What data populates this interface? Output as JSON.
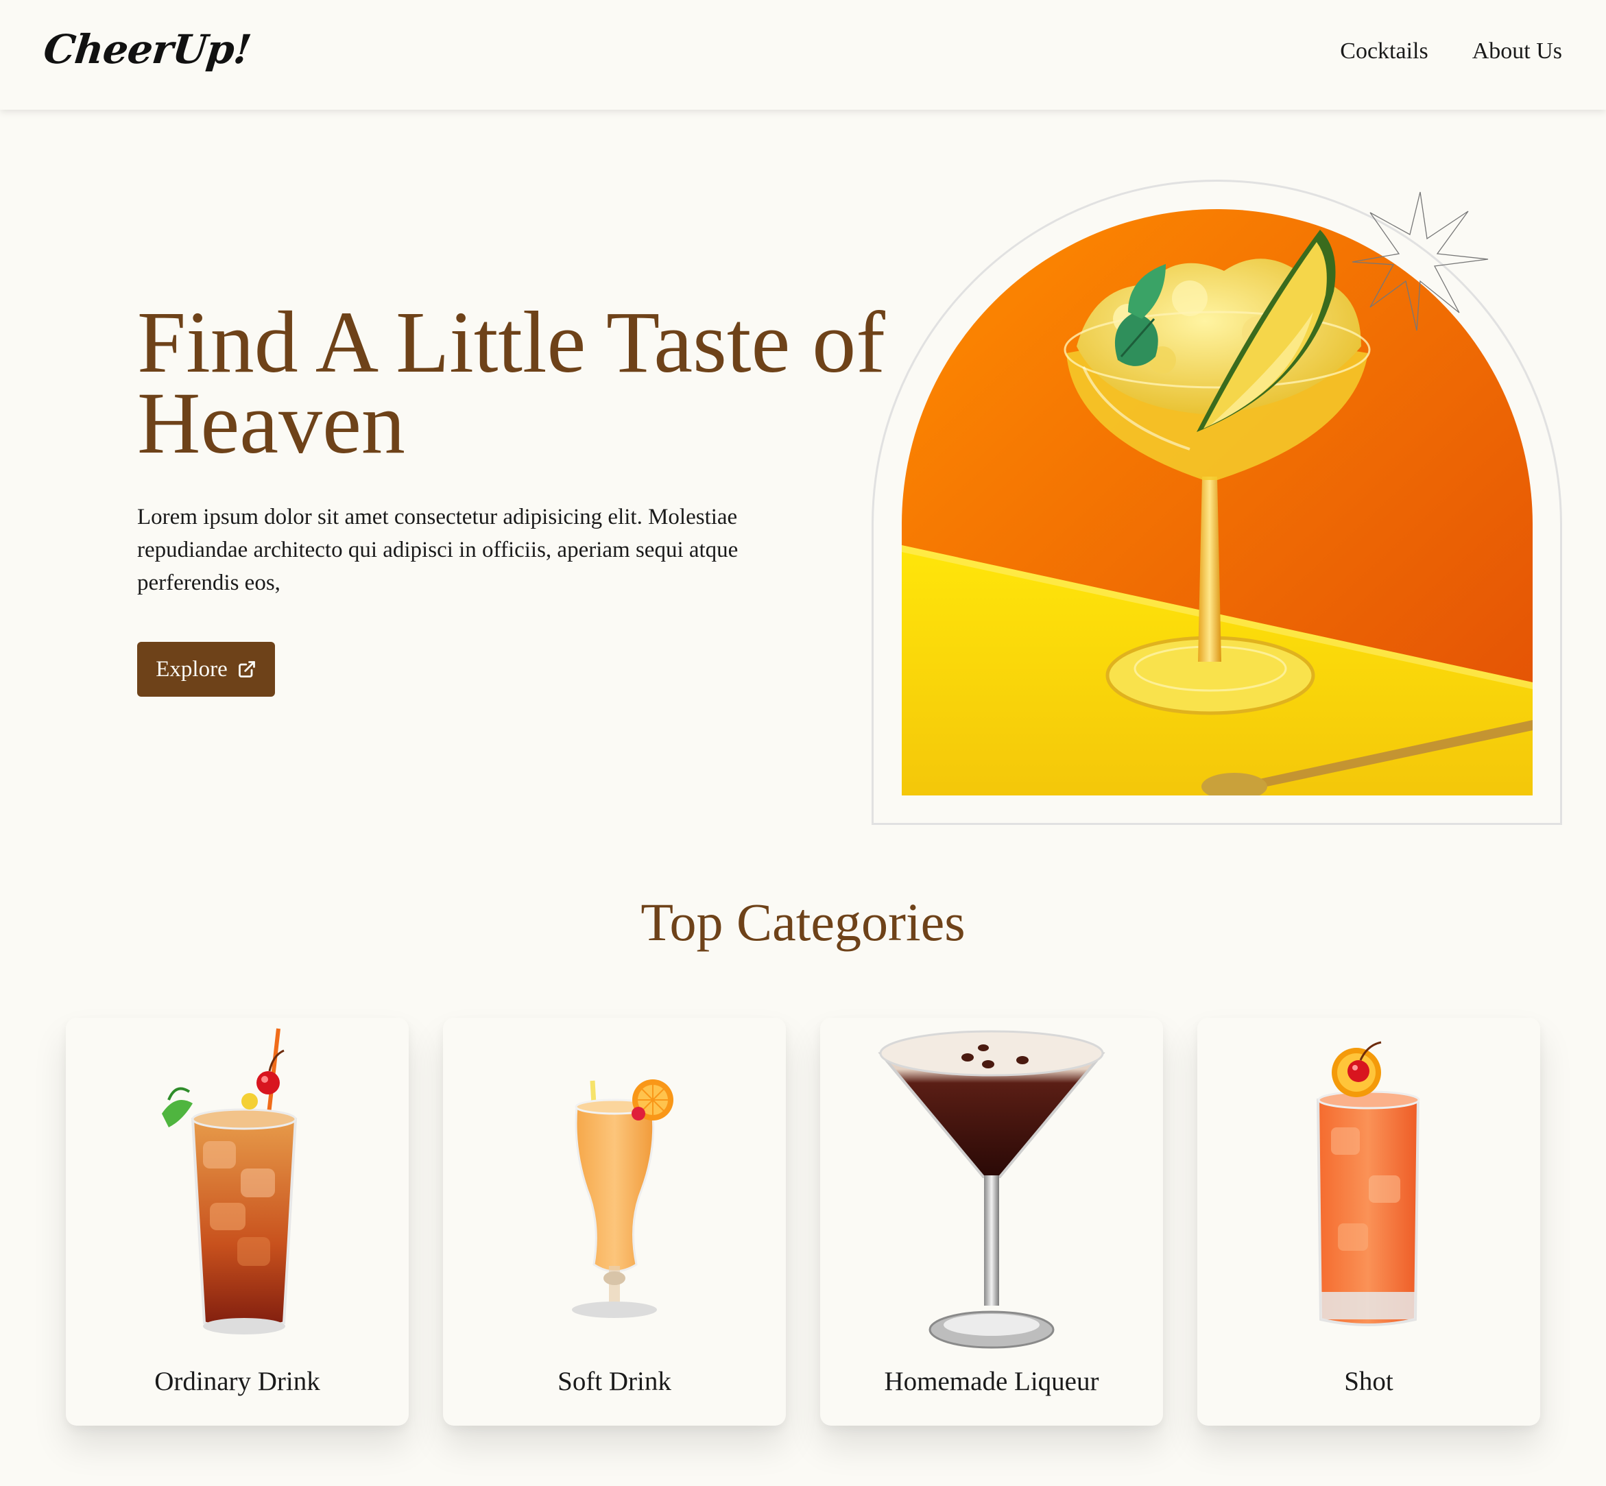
{
  "navbar": {
    "logo": "CheerUp!",
    "links": [
      "Cocktails",
      "About Us"
    ]
  },
  "hero": {
    "title": "Find A Little Taste of Heaven",
    "description": "Lorem ipsum dolor sit amet consectetur adipisicing elit. Molestiae repudiandae architecto qui adipisci in officiis, aperiam sequi atque perferendis eos,",
    "button_label": "Explore",
    "button_icon": "external-link-icon"
  },
  "categories": {
    "title": "Top Categories",
    "items": [
      {
        "label": "Ordinary Drink"
      },
      {
        "label": "Soft Drink"
      },
      {
        "label": "Homemade Liqueur"
      },
      {
        "label": "Shot"
      }
    ]
  },
  "colors": {
    "background": "#fbfaf5",
    "accent_brown": "#6e4219",
    "hero_orange": "#f47b0b",
    "hero_yellow": "#f8d90f"
  }
}
